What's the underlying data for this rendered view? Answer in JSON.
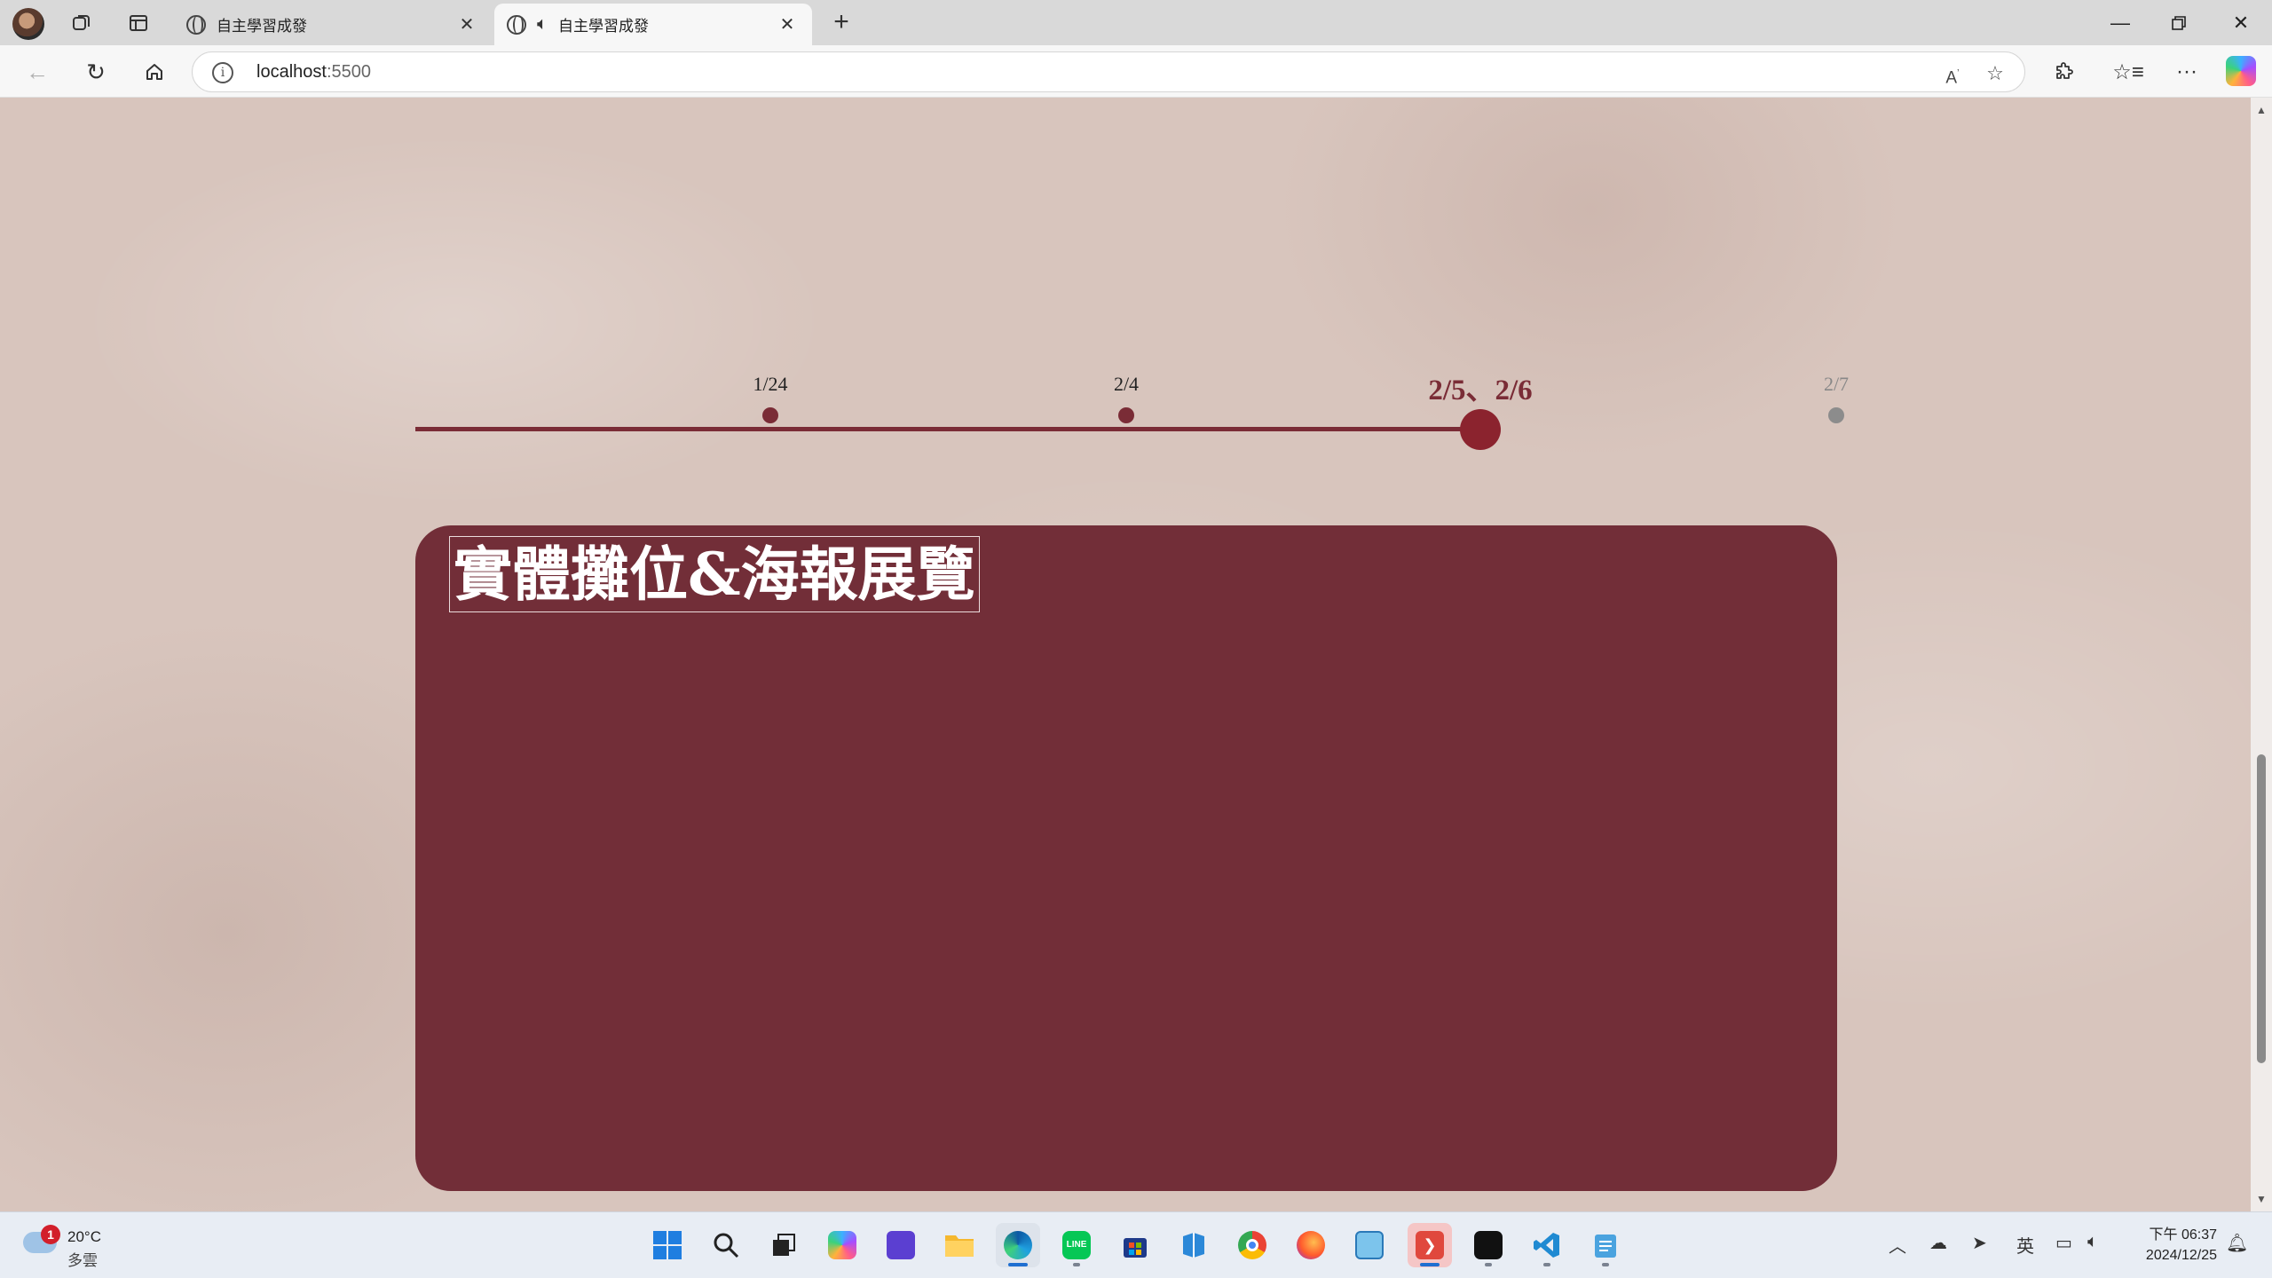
{
  "browser": {
    "tabs": [
      {
        "title": "自主學習成發",
        "active": false
      },
      {
        "title": "自主學習成發",
        "active": true,
        "audio": true
      }
    ],
    "address": {
      "host": "localhost",
      "port": ":5500"
    }
  },
  "timeline": {
    "items": [
      {
        "label": "1/24",
        "state": "past"
      },
      {
        "label": "2/4",
        "state": "past"
      },
      {
        "label": "2/5、2/6",
        "state": "current"
      },
      {
        "label": "2/7",
        "state": "future"
      }
    ]
  },
  "card": {
    "title": "實體攤位&海報展覽"
  },
  "colors": {
    "accent": "#7a2c36",
    "card": "#722e38",
    "background": "#d8c5bd"
  },
  "taskbar": {
    "weather": {
      "badge": "1",
      "temp": "20°C",
      "condition": "多雲"
    },
    "tray": {
      "ime": "英"
    },
    "clock": {
      "time": "下午 06:37",
      "date": "2024/12/25"
    }
  }
}
